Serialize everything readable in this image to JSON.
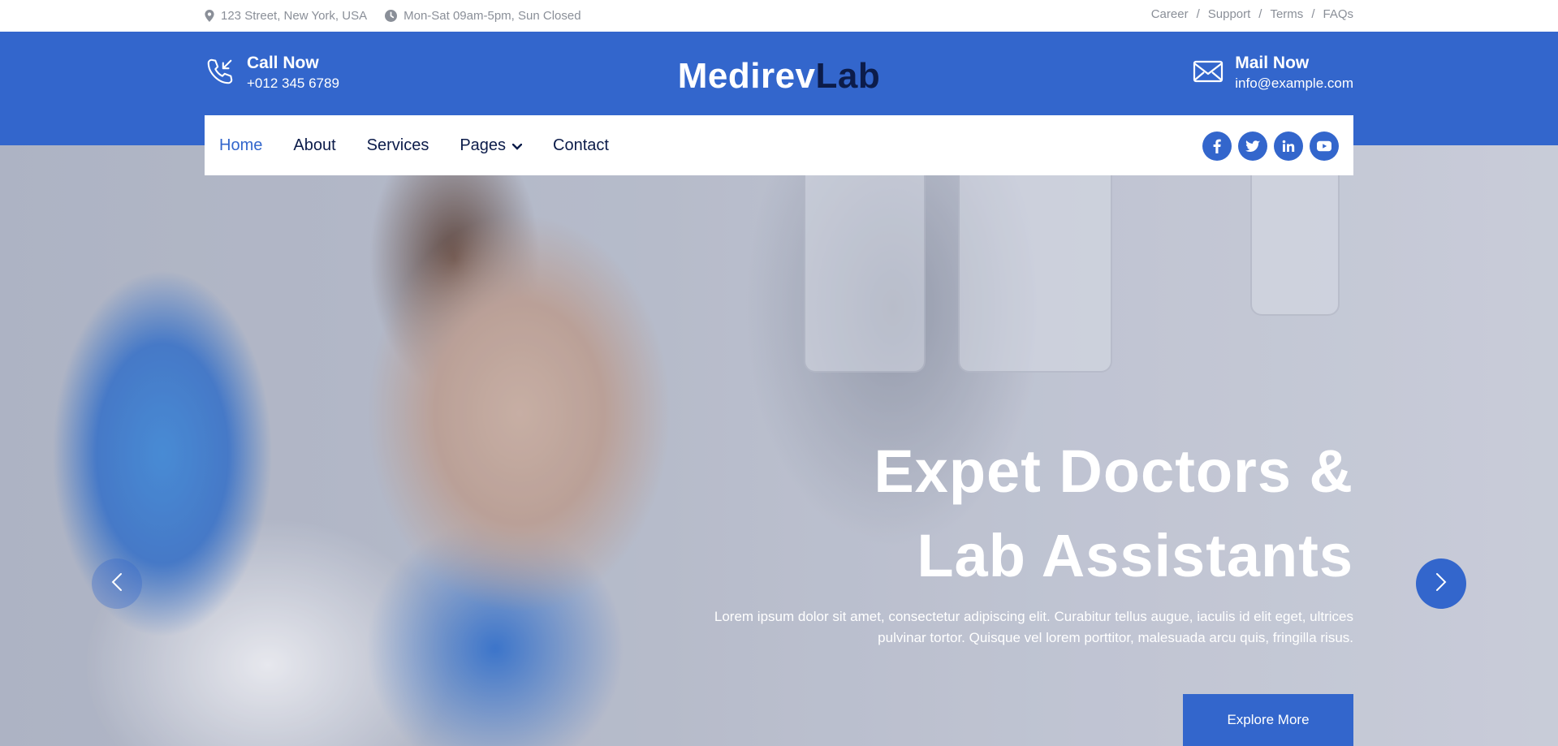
{
  "topbar": {
    "address": "123 Street, New York, USA",
    "hours": "Mon-Sat 09am-5pm, Sun Closed",
    "links": [
      "Career",
      "Support",
      "Terms",
      "FAQs"
    ],
    "separator": "/"
  },
  "header": {
    "call_title": "Call Now",
    "call_value": "+012 345 6789",
    "logo_part1": "Medirev",
    "logo_part2": "Lab",
    "mail_title": "Mail Now",
    "mail_value": "info@example.com"
  },
  "nav": {
    "items": [
      "Home",
      "About",
      "Services",
      "Pages",
      "Contact"
    ],
    "active": "Home"
  },
  "social": {
    "icons": [
      "facebook-icon",
      "twitter-icon",
      "linkedin-icon",
      "youtube-icon"
    ]
  },
  "hero": {
    "title_line1": "Expet Doctors &",
    "title_line2": "Lab Assistants",
    "text": "Lorem ipsum dolor sit amet, consectetur adipiscing elit. Curabitur tellus augue, iaculis id elit eget, ultrices pulvinar tortor. Quisque vel lorem porttitor, malesuada arcu quis, fringilla risus.",
    "button": "Explore More"
  },
  "colors": {
    "primary": "#3366cc",
    "dark": "#0c1c4a",
    "muted": "#8a8f98"
  }
}
